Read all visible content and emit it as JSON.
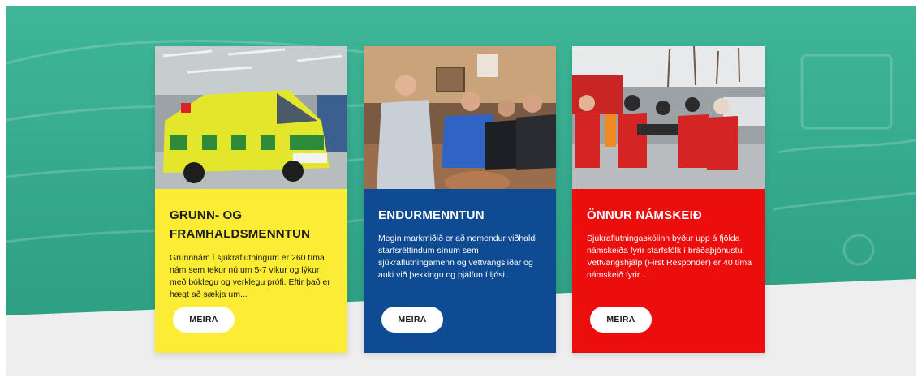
{
  "colors": {
    "teal": "#3cb294",
    "light_gray": "#eeeeee",
    "yellow": "#fcec33",
    "blue": "#0e4b93",
    "red": "#ec0d0d",
    "button_bg": "#ffffff"
  },
  "cards": [
    {
      "title": "GRUNN- OG FRAMHALDSMENNTUN",
      "text": "Grunnnám í sjúkraflutningum er 260 tíma nám sem tekur nú um 5-7 vikur og lýkur með bóklegu og verklegu prófi. Eftir það er hægt að sækja um...",
      "button_label": "MEIRA"
    },
    {
      "title": "ENDURMENNTUN",
      "text": "Megin markmiðið er að nemendur viðhaldi starfsréttindum sínum sem sjúkraflutningamenn og vettvangsliðar og auki við þekkingu og þjálfun í ljósi...",
      "button_label": "MEIRA"
    },
    {
      "title": "ÖNNUR NÁMSKEIÐ",
      "text": "Sjúkraflutningaskólinn býður upp á fjölda námskeiða fyrir starfsfólk í bráðaþjónustu.  Vettvangshjálp (First Responder) er 40 tíma námskeið fyrir...",
      "button_label": "MEIRA"
    }
  ]
}
